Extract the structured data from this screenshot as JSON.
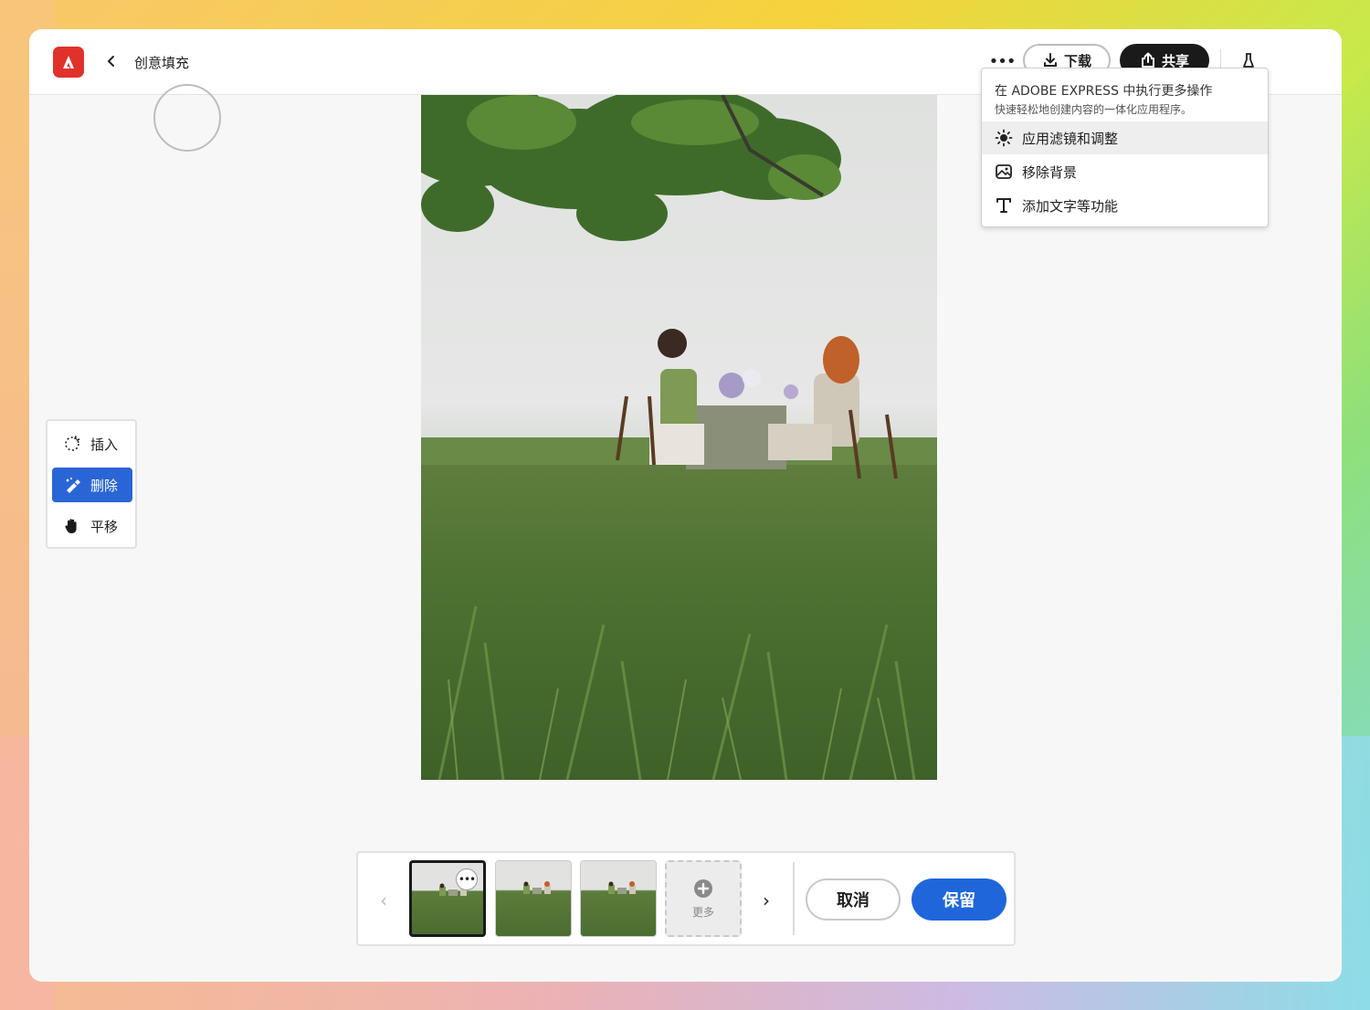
{
  "header": {
    "title": "创意填充",
    "more_label": "•••",
    "download_label": "下载",
    "share_label": "共享"
  },
  "dropdown": {
    "title": "在 ADOBE EXPRESS 中执行更多操作",
    "subtitle": "快速轻松地创建内容的一体化应用程序。",
    "items": [
      {
        "label": "应用滤镜和调整",
        "icon": "brightness-icon",
        "active": true
      },
      {
        "label": "移除背景",
        "icon": "image-remove-bg-icon",
        "active": false
      },
      {
        "label": "添加文字等功能",
        "icon": "text-icon",
        "active": false
      }
    ]
  },
  "tools": [
    {
      "label": "插入",
      "icon": "insert-icon",
      "active": false
    },
    {
      "label": "删除",
      "icon": "remove-icon",
      "active": true
    },
    {
      "label": "平移",
      "icon": "hand-icon",
      "active": false
    }
  ],
  "bottom_bar": {
    "add_more_label": "更多",
    "cancel_label": "取消",
    "keep_label": "保留",
    "thumb_more_label": "•••"
  },
  "colors": {
    "accent": "#1f66db",
    "logo": "#e0322b",
    "share_bg": "#1a1a1a"
  }
}
